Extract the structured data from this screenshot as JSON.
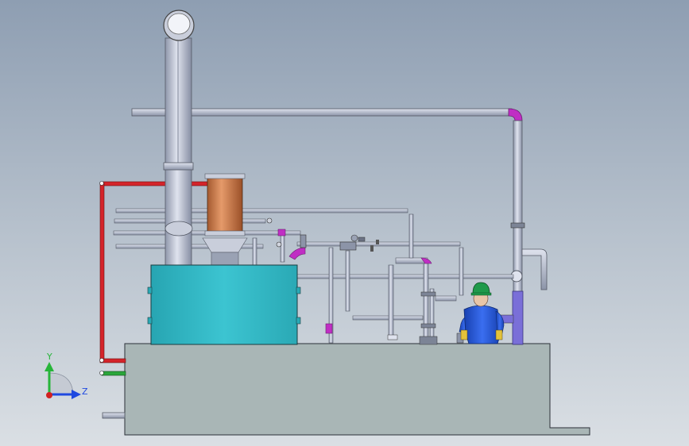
{
  "viewport": {
    "background_top": "#8e9eb2",
    "background_bottom": "#dadfe4"
  },
  "model": {
    "colors": {
      "pipe": "#b6bdcf",
      "pipe_edge": "#555a66",
      "tank": "#2fb6c3",
      "base": "#a9b6b6",
      "column": "#ba7448",
      "red_line": "#d4242a",
      "green_line": "#2aa63a",
      "magenta": "#c02ec4",
      "worker": "#1f4fc9",
      "helmet": "#1f9a4a"
    },
    "components": [
      "stack",
      "horizontal-pipe",
      "copper-column",
      "tank",
      "base-platform",
      "worker-figure"
    ]
  },
  "triad": {
    "y_label": "Y",
    "z_label": "Z",
    "y_color": "#27b53a",
    "z_color": "#1f49e0",
    "x_color": "#d22020"
  }
}
